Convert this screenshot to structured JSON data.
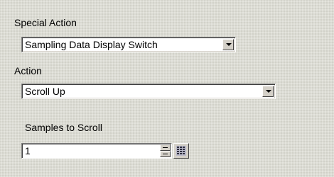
{
  "special_action": {
    "label": "Special Action",
    "selected": "Sampling Data Display Switch"
  },
  "action": {
    "label": "Action",
    "selected": "Scroll Up"
  },
  "samples_to_scroll": {
    "label": "Samples to Scroll",
    "value": "1"
  },
  "icons": {
    "dropdown": "chevron-down-icon",
    "spinner": "spin-up-down-icon",
    "keypad": "keypad-icon"
  }
}
